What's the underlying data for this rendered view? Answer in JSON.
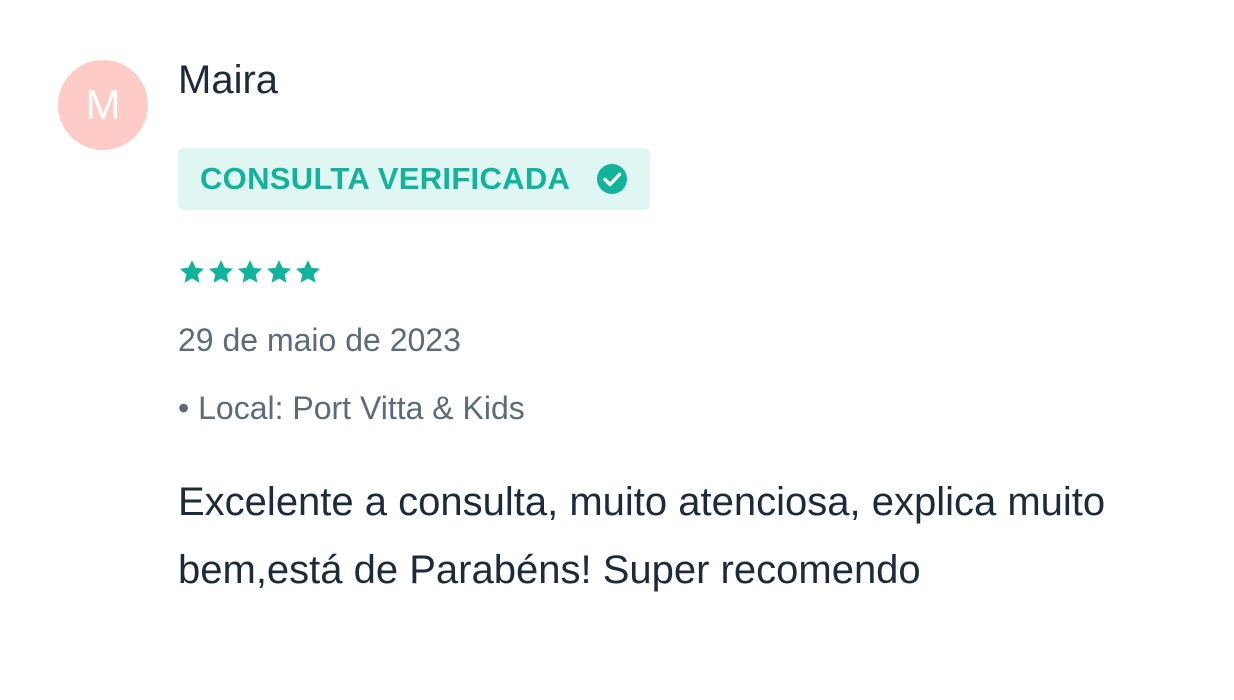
{
  "reviewer": {
    "initial": "M",
    "name": "Maira",
    "avatar_color": "#ffcbc6"
  },
  "badge": {
    "label": "CONSULTA VERIFICADA",
    "icon": "check-circle-icon",
    "color": "#12b39b",
    "background": "#dff6f3"
  },
  "rating": {
    "stars": 5,
    "max": 5,
    "color": "#12b39b"
  },
  "review": {
    "date": "29 de maio de 2023",
    "location": "• Local: Port Vitta & Kids",
    "text": "Excelente a consulta, muito atenciosa, explica muito bem,está de Parabéns! Super recomendo"
  }
}
